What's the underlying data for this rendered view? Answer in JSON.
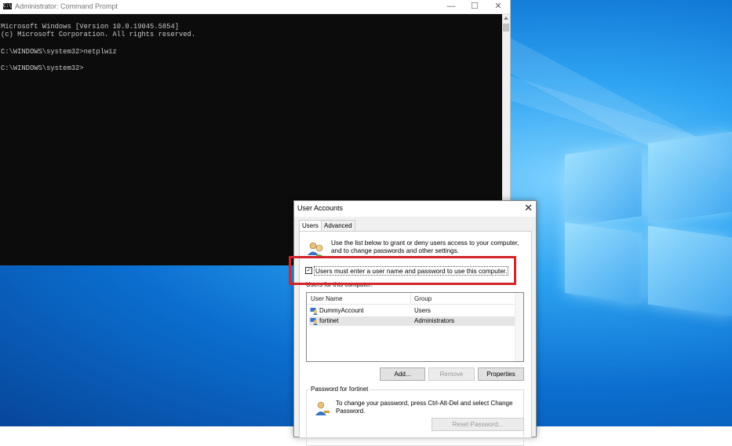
{
  "cmd": {
    "title": "Administrator: Command Prompt",
    "icon_label": "C:\\",
    "lines": [
      "Microsoft Windows [Version 10.0.19045.5854]",
      "(c) Microsoft Corporation. All rights reserved.",
      "",
      "C:\\WINDOWS\\system32>netplwiz",
      "",
      "C:\\WINDOWS\\system32>"
    ],
    "controls": {
      "minimize": "—",
      "maximize": "☐",
      "close": "✕"
    }
  },
  "dialog": {
    "title": "User Accounts",
    "close": "✕",
    "tabs": [
      {
        "label": "Users",
        "active": true
      },
      {
        "label": "Advanced",
        "active": false
      }
    ],
    "intro": "Use the list below to grant or deny users access to your computer, and to change passwords and other settings.",
    "checkbox": {
      "label": "Users must enter a user name and password to use this computer.",
      "checked": true,
      "mark": "✓"
    },
    "list_caption": "Users for this computer:",
    "columns": {
      "user_name": "User Name",
      "group": "Group"
    },
    "rows": [
      {
        "name": "DummyAccount",
        "group": "Users",
        "selected": false
      },
      {
        "name": "fortinet",
        "group": "Administrators",
        "selected": true
      }
    ],
    "buttons": {
      "add": "Add...",
      "remove": "Remove",
      "properties": "Properties"
    },
    "password_group": {
      "legend": "Password for fortinet",
      "text": "To change your password, press Ctrl-Alt-Del and select Change Password.",
      "reset": "Reset Password..."
    }
  },
  "colors": {
    "highlight": "#d3262b",
    "console_bg": "#0c0c0c",
    "console_fg": "#c8c8c8"
  }
}
